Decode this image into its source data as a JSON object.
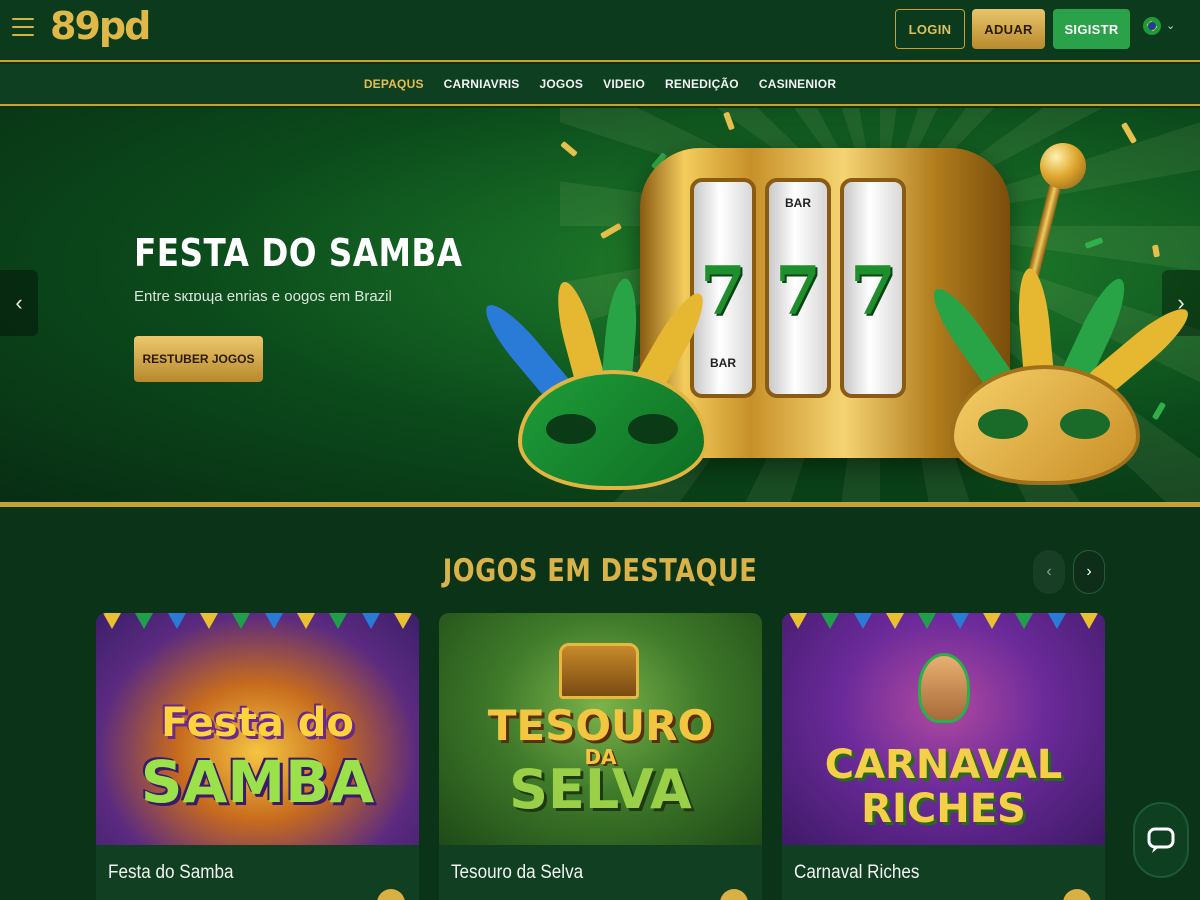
{
  "header": {
    "logo": "89pd",
    "login_label": "LOGIN",
    "aduar_label": "ADUAR",
    "register_label": "SIGISTR"
  },
  "nav": {
    "items": [
      "DEPAQUS",
      "CARNIAVRIS",
      "JOGOS",
      "VIDEIO",
      "RENEDIÇÃO",
      "CASINENIOR"
    ],
    "active_index": 0
  },
  "hero": {
    "title": "FESTA DO SAMBA",
    "subtitle": "Entre sкɪɒɰa enrias e oogos em Brazil",
    "cta_label": "RESTUBER JOGOS",
    "reel_symbols_top": [
      "",
      "BAR",
      ""
    ],
    "reel_numbers": [
      "7",
      "7",
      "7"
    ],
    "reel_symbols_bottom": [
      "BAR",
      "",
      ""
    ]
  },
  "featured": {
    "title": "JOGOS EM DESTAQUE",
    "games": [
      {
        "name": "Festa do Samba",
        "art_line1": "Festa do",
        "art_line2": "SAMBA"
      },
      {
        "name": "Tesouro da Selva",
        "art_line1": "TESOURO",
        "art_mid": "DA",
        "art_line2": "SELVA"
      },
      {
        "name": "Carnaval Riches",
        "art_line1": "CARNAVAL",
        "art_line2": "RICHES"
      }
    ]
  },
  "colors": {
    "background": "#0a3318",
    "gold": "#c9a032",
    "accent_gold_text": "#d9b24a",
    "register_green": "#2aa24a"
  },
  "icons": {
    "menu": "hamburger-icon",
    "language": "brazil-flag-icon",
    "chat": "chat-icon"
  }
}
